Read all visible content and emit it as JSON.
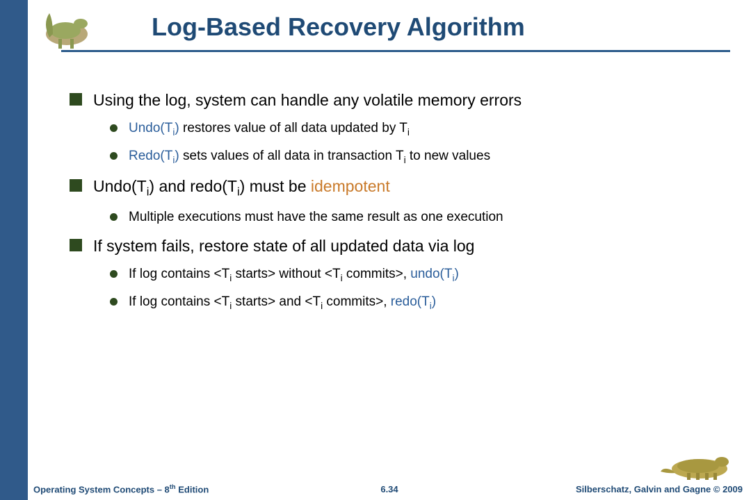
{
  "title": "Log-Based Recovery Algorithm",
  "bullets": [
    {
      "text": "Using the log, system can handle any volatile memory errors",
      "sub": [
        {
          "html": "<span class='hl-blue'>Undo(T<span class='sub'>i</span>)</span> restores value of all data updated by T<span class='sub'>i</span>"
        },
        {
          "html": "<span class='hl-blue'>Redo(T<span class='sub'>i</span>)</span> sets values of all data in transaction T<span class='sub'>i</span> to new values"
        }
      ]
    },
    {
      "html": "Undo(T<span class='sub'>i</span>) and redo(T<span class='sub'>i</span>) must be <span class='hl-orange'>idempotent</span>",
      "sub": [
        {
          "text": "Multiple executions must have the same result as one execution"
        }
      ]
    },
    {
      "text": "If system fails, restore state of all updated data via log",
      "sub": [
        {
          "html": "If log contains &lt;T<span class='sub'>i</span> starts&gt; without &lt;T<span class='sub'>i</span> commits&gt;, <span class='hl-blue'>undo(T<span class='sub'>i</span>)</span>"
        },
        {
          "html": "If log contains &lt;T<span class='sub'>i</span> starts&gt; and &lt;T<span class='sub'>i</span> commits&gt;, <span class='hl-blue'>redo(T<span class='sub'>i</span>)</span>"
        }
      ]
    }
  ],
  "footer": {
    "left_prefix": "Operating System Concepts – 8",
    "left_suffix": " Edition",
    "left_sup": "th",
    "center": "6.34",
    "right": "Silberschatz, Galvin and Gagne © 2009"
  }
}
